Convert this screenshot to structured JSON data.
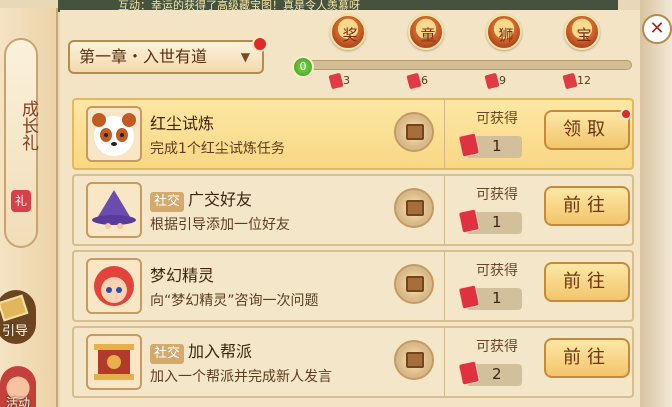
{
  "ticker": {
    "text": "互动：幸运的获得了高级藏宝图！真是令人羡慕呀"
  },
  "sidebar": {
    "growth_tab_label": "成长礼",
    "growth_icon_glyph": "礼",
    "guide_label": "引导",
    "girl_label": "活动"
  },
  "chapter": {
    "label": "第一章・入世有道",
    "chevron": "▼"
  },
  "progress": {
    "current": "0"
  },
  "milestones": [
    {
      "glyph": "奖",
      "count": "3"
    },
    {
      "glyph": "童",
      "count": "6"
    },
    {
      "glyph": "狮",
      "count": "9"
    },
    {
      "glyph": "宝",
      "count": "12"
    }
  ],
  "tasks": [
    {
      "title": "红尘试炼",
      "tag": "",
      "desc": "完成1个红尘试炼任务",
      "obtain": "可获得",
      "reward": "1",
      "button": "领取"
    },
    {
      "title": "广交好友",
      "tag": "社交",
      "desc": "根据引导添加一位好友",
      "obtain": "可获得",
      "reward": "1",
      "button": "前往"
    },
    {
      "title": "梦幻精灵",
      "tag": "",
      "desc": "向“梦幻精灵”咨询一次问题",
      "obtain": "可获得",
      "reward": "1",
      "button": "前往"
    },
    {
      "title": "加入帮派",
      "tag": "社交",
      "desc": "加入一个帮派并完成新人发言",
      "obtain": "可获得",
      "reward": "2",
      "button": "前往"
    }
  ],
  "close_glyph": "✕"
}
